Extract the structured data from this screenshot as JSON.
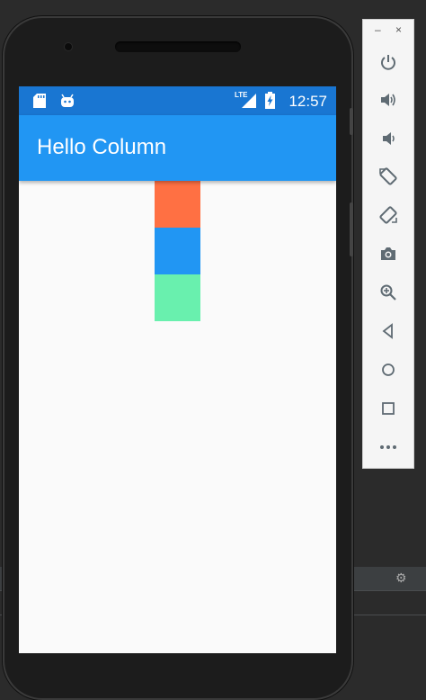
{
  "app": {
    "title": "Hello Column",
    "status_time": "12:57",
    "network_label": "LTE"
  },
  "column_boxes": [
    {
      "color": "#ff7043"
    },
    {
      "color": "#2196f3"
    },
    {
      "color": "#69f0ae"
    }
  ],
  "colors": {
    "status_bar": "#1976d2",
    "app_bar": "#2196f3",
    "background": "#fafafa"
  },
  "emulator_toolbar": {
    "window_controls": [
      "–",
      "×"
    ],
    "icons": [
      "power-icon",
      "volume-up-icon",
      "volume-down-icon",
      "rotate-left-icon",
      "rotate-right-icon",
      "camera-icon",
      "zoom-icon",
      "back-icon",
      "home-icon",
      "overview-icon",
      "more-icon"
    ]
  }
}
